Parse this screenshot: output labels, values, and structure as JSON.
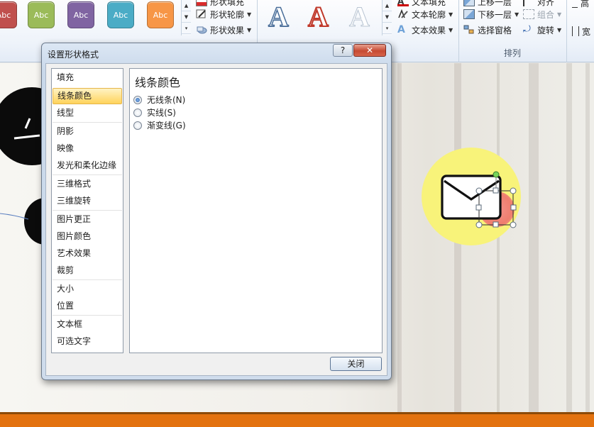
{
  "ribbon": {
    "shape_styles": [
      {
        "label": "Abc",
        "color": "#c0504d"
      },
      {
        "label": "Abc",
        "color": "#9bbb59"
      },
      {
        "label": "Abc",
        "color": "#8064a2"
      },
      {
        "label": "Abc",
        "color": "#4bacc6"
      },
      {
        "label": "Abc",
        "color": "#f79646"
      }
    ],
    "shape_fill": "形状填充",
    "shape_outline": "形状轮廓",
    "shape_effects": "形状效果",
    "wordart_letters": [
      "A",
      "A",
      "A"
    ],
    "text_fill": "文本填充",
    "text_outline": "文本轮廓",
    "text_effects": "文本效果",
    "bring_forward": "上移一层",
    "send_backward": "下移一层",
    "selection_pane": "选择窗格",
    "align": "对齐",
    "group": "组合",
    "rotate": "旋转",
    "arrange_label": "排列",
    "height_label": "高",
    "width_label": "宽"
  },
  "dialog": {
    "title": "设置形状格式",
    "help": "?",
    "close_x": "✕",
    "nav": [
      "填充",
      "线条颜色",
      "线型",
      "阴影",
      "映像",
      "发光和柔化边缘",
      "三维格式",
      "三维旋转",
      "图片更正",
      "图片颜色",
      "艺术效果",
      "裁剪",
      "大小",
      "位置",
      "文本框",
      "可选文字"
    ],
    "selected_index": 1,
    "panel_title": "线条颜色",
    "options": [
      {
        "label": "无线条(N)",
        "checked": true
      },
      {
        "label": "实线(S)",
        "checked": false
      },
      {
        "label": "渐变线(G)",
        "checked": false
      }
    ],
    "close_button": "关闭"
  },
  "colors": {
    "accent_orange": "#e3720f",
    "yellow_circle": "#f8f37a",
    "red_circle": "#f08a80"
  }
}
